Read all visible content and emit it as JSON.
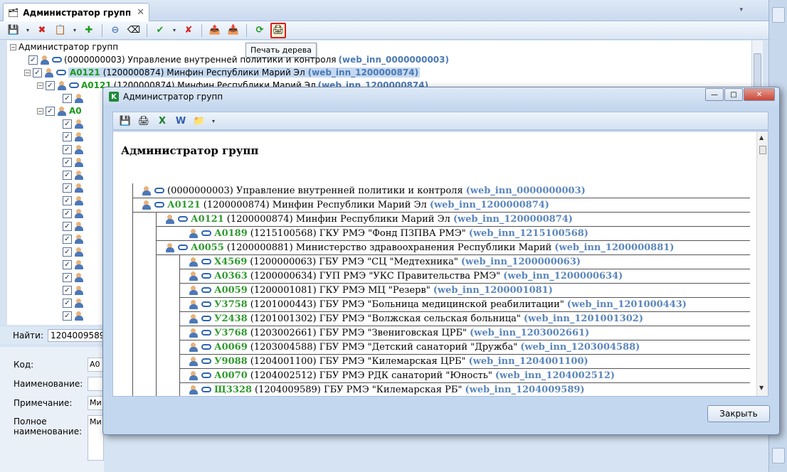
{
  "tab": {
    "title": "Администратор групп",
    "close": "✕"
  },
  "tooltip": "Печать дерева",
  "tree": {
    "root": "Администратор групп",
    "rows": [
      {
        "code": "",
        "num": "(0000000003) Управление внутренней политики и контроля",
        "inn": "(web_inn_0000000003)"
      },
      {
        "code": "А0121",
        "num": "(1200000874) Минфин Республики Марий Эл",
        "inn": "(web_inn_1200000874)"
      },
      {
        "code": "А0121",
        "num": "(1200000874) Минфин Республики Марий Эл",
        "inn": "(web_inn_1200000874)"
      },
      {
        "code": "А0",
        "num": "",
        "inn": ""
      }
    ]
  },
  "find": {
    "label": "Найти:",
    "value": "1204009589"
  },
  "details": {
    "code_label": "Код:",
    "code_value": "А0",
    "name_label": "Наименование:",
    "note_label": "Примечание:",
    "note_value": "Ми",
    "fullname_label": "Полное наименование:",
    "fullname_value": "Ми"
  },
  "dialog": {
    "title": "Администратор групп",
    "app_icon": "K",
    "preview_title": "Администратор групп",
    "close_button": "Закрыть",
    "rows": [
      {
        "code": "",
        "num": "(0000000003) Управление внутренней политики и контроля",
        "inn": "(web_inn_0000000003)"
      },
      {
        "code": "А0121",
        "num": "(1200000874) Минфин Республики Марий Эл",
        "inn": "(web_inn_1200000874)"
      },
      {
        "code": "А0121",
        "num": "(1200000874) Минфин Республики Марий Эл",
        "inn": "(web_inn_1200000874)"
      },
      {
        "code": "А0189",
        "num": "(1215100568) ГКУ РМЭ \"Фонд ПЗПВА РМЭ\"",
        "inn": "(web_inn_1215100568)"
      },
      {
        "code": "А0055",
        "num": "(1200000881) Министерство здравоохранения Республики Марий",
        "inn": "(web_inn_1200000881)"
      },
      {
        "code": "Х4569",
        "num": "(1200000063) ГБУ РМЭ \"СЦ \"Медтехника\"",
        "inn": "(web_inn_1200000063)"
      },
      {
        "code": "А0363",
        "num": "(1200000634) ГУП РМЭ \"УКС Правительства РМЭ\"",
        "inn": "(web_inn_1200000634)"
      },
      {
        "code": "А0059",
        "num": "(1200001081) ГКУ РМЭ МЦ \"Резерв\"",
        "inn": "(web_inn_1200001081)"
      },
      {
        "code": "У3758",
        "num": "(1201000443) ГБУ РМЭ \"Больница медицинской реабилитации\"",
        "inn": "(web_inn_1201000443)"
      },
      {
        "code": "У2438",
        "num": "(1201001302) ГБУ РМЭ \"Волжская сельская больница\"",
        "inn": "(web_inn_1201001302)"
      },
      {
        "code": "У3768",
        "num": "(1203002661) ГБУ РМЭ \"Звениговская ЦРБ\"",
        "inn": "(web_inn_1203002661)"
      },
      {
        "code": "А0069",
        "num": "(1203004588) ГБУ РМЭ \"Детский санаторий \"Дружба\"",
        "inn": "(web_inn_1203004588)"
      },
      {
        "code": "У9088",
        "num": "(1204001100) ГБУ РМЭ \"Килемарская ЦРБ\"",
        "inn": "(web_inn_1204001100)"
      },
      {
        "code": "А0070",
        "num": "(1204002512) ГБУ РМЭ РДК санаторий \"Юность\"",
        "inn": "(web_inn_1204002512)"
      },
      {
        "code": "Щ3328",
        "num": "(1204009589) ГБУ РМЭ \"Килемарская РБ\"",
        "inn": "(web_inn_1204009589)"
      }
    ]
  },
  "icons": {
    "save": "💾",
    "delete": "✖",
    "add_child": "📋",
    "add": "✚",
    "link": "⊖",
    "eraser": "⌫",
    "check": "✔",
    "uncheck": "✘",
    "export": "📤",
    "import": "📥",
    "refresh": "⟳",
    "print": "🖨",
    "excel": "X",
    "word": "W",
    "folder": "📁",
    "dropdown": "▾",
    "min": "—",
    "max": "□",
    "close": "✕"
  },
  "colors": {
    "code_green": "#1a9a1a",
    "inn_blue": "#4a79b5",
    "highlight_red": "#e01b1b",
    "selection": "#c5d9f1"
  }
}
